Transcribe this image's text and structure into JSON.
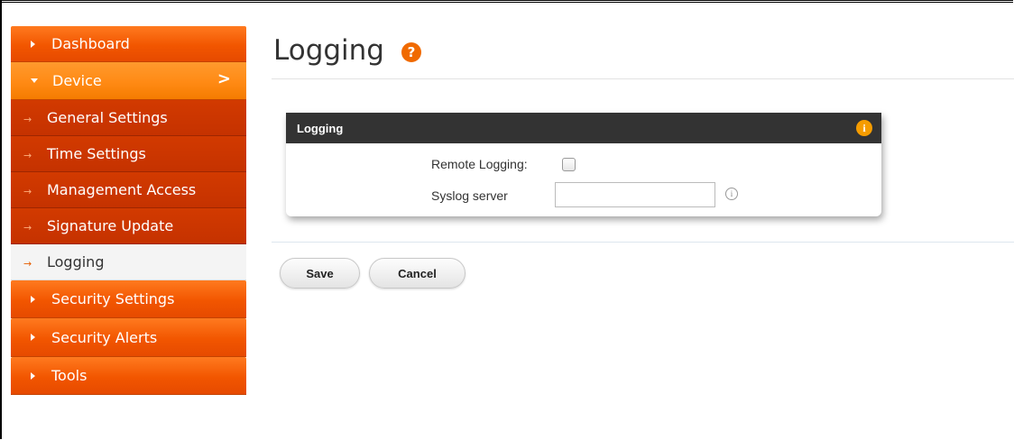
{
  "sidebar": {
    "items": [
      {
        "label": "Dashboard",
        "type": "main"
      },
      {
        "label": "Device",
        "type": "expanded"
      },
      {
        "label": "General Settings",
        "type": "sub"
      },
      {
        "label": "Time Settings",
        "type": "sub"
      },
      {
        "label": "Management Access",
        "type": "sub"
      },
      {
        "label": "Signature Update",
        "type": "sub"
      },
      {
        "label": "Logging",
        "type": "sub-active"
      },
      {
        "label": "Security Settings",
        "type": "main"
      },
      {
        "label": "Security Alerts",
        "type": "main"
      },
      {
        "label": "Tools",
        "type": "main"
      }
    ],
    "chevron": ">",
    "sub_arrow": "→"
  },
  "page": {
    "title": "Logging",
    "help_glyph": "?"
  },
  "panel": {
    "title": "Logging",
    "info_glyph": "i",
    "remote_logging_label": "Remote Logging:",
    "remote_logging_checked": false,
    "syslog_label": "Syslog server",
    "syslog_value": "",
    "syslog_info_glyph": "i"
  },
  "buttons": {
    "save": "Save",
    "cancel": "Cancel"
  },
  "colors": {
    "accent": "#f25600",
    "device_highlight": "#ff8a14",
    "submenu": "#c53200",
    "panel_header": "#333333",
    "info_icon": "#f59c00"
  }
}
